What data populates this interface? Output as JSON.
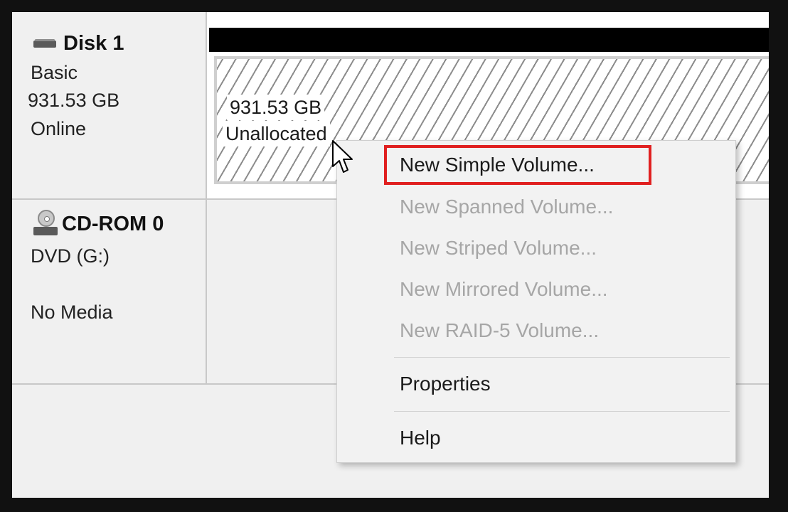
{
  "disk": {
    "name": "Disk 1",
    "type": "Basic",
    "size": "931.53 GB",
    "status": "Online",
    "icon": "hard-disk-icon"
  },
  "cdrom": {
    "name": "CD-ROM 0",
    "drive": "DVD (G:)",
    "status": "No Media",
    "icon": "cd-rom-icon"
  },
  "volume": {
    "size": "931.53 GB",
    "status": "Unallocated"
  },
  "context_menu": {
    "items": [
      {
        "label": "New Simple Volume...",
        "enabled": true,
        "highlighted": true
      },
      {
        "label": "New Spanned Volume...",
        "enabled": false
      },
      {
        "label": "New Striped Volume...",
        "enabled": false
      },
      {
        "label": "New Mirrored Volume...",
        "enabled": false
      },
      {
        "label": "New RAID-5 Volume...",
        "enabled": false
      },
      {
        "label": "Properties",
        "enabled": true
      },
      {
        "label": "Help",
        "enabled": true
      }
    ]
  },
  "colors": {
    "highlight_border": "#e02020",
    "disabled_text": "#a6a6a6",
    "volume_header": "#000000"
  }
}
